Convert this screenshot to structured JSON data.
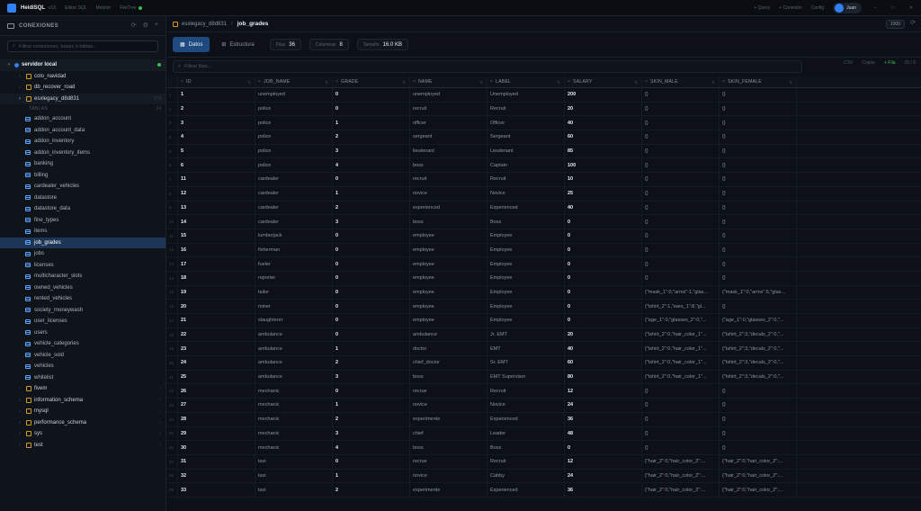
{
  "titlebar": {
    "app_name": "HeidiSQL",
    "version": "v13",
    "links": [
      "Editor SQL",
      "Monitor",
      "FileTree"
    ],
    "right": [
      "+ Query",
      "+ Conexión",
      "Config"
    ],
    "user": "Juan"
  },
  "sidebar": {
    "title": "CONEXIONES",
    "search_placeholder": "Filtrar conexiones, bases o tablas...",
    "server": {
      "label": "servidor local"
    },
    "databases_before": [
      {
        "label": "colo_navidad"
      },
      {
        "label": "db_recover_road"
      }
    ],
    "active_db": {
      "label": "esxlegacy_d8d831",
      "count": "174"
    },
    "tables_section": "TABLAS",
    "tables_count": "24",
    "tables": [
      "addon_account",
      "addon_account_data",
      "addon_inventory",
      "addon_inventory_items",
      "banking",
      "billing",
      "cardealer_vehicles",
      "datastore",
      "datastore_data",
      "fine_types",
      "items",
      "job_grades",
      "jobs",
      "licenses",
      "multicharacter_slots",
      "owned_vehicles",
      "rented_vehicles",
      "society_moneywash",
      "user_licenses",
      "users",
      "vehicle_categories",
      "vehicle_sold",
      "vehicles",
      "whitelist"
    ],
    "active_table": "job_grades",
    "databases_after": [
      {
        "label": "fivem"
      },
      {
        "label": "information_schema"
      },
      {
        "label": "mysql"
      },
      {
        "label": "performance_schema"
      },
      {
        "label": "sys"
      },
      {
        "label": "test"
      }
    ]
  },
  "crumb": {
    "db": "esxlegacy_d8d831",
    "table": "job_grades",
    "rows_badge": "1000"
  },
  "tabs": [
    {
      "label": "Datos",
      "icon": "grid-icon",
      "active": true
    },
    {
      "label": "Estructura",
      "icon": "structure-icon",
      "active": false
    }
  ],
  "stats": [
    {
      "k": "Filas",
      "v": "36"
    },
    {
      "k": "Columnas",
      "v": "8"
    },
    {
      "k": "Tamaño",
      "v": "16.0 KB"
    }
  ],
  "filter_placeholder": "Filtrar filas...",
  "filter_actions": [
    "CSV",
    "Copiar",
    "+ Fila",
    "25 / 8"
  ],
  "columns": [
    "ID",
    "JOB_NAME",
    "GRADE",
    "NAME",
    "LABEL",
    "SALARY",
    "SKIN_MALE",
    "SKIN_FEMALE"
  ],
  "rows": [
    [
      "1",
      "1",
      "unemployed",
      "0",
      "unemployed",
      "Unemployed",
      "200",
      "{}",
      "{}"
    ],
    [
      "2",
      "2",
      "police",
      "0",
      "recruit",
      "Recruit",
      "20",
      "{}",
      "{}"
    ],
    [
      "3",
      "3",
      "police",
      "1",
      "officer",
      "Officer",
      "40",
      "{}",
      "{}"
    ],
    [
      "4",
      "4",
      "police",
      "2",
      "sergeant",
      "Sergeant",
      "60",
      "{}",
      "{}"
    ],
    [
      "5",
      "5",
      "police",
      "3",
      "lieutenant",
      "Lieutenant",
      "85",
      "{}",
      "{}"
    ],
    [
      "6",
      "6",
      "police",
      "4",
      "boss",
      "Captain",
      "100",
      "{}",
      "{}"
    ],
    [
      "7",
      "11",
      "cardealer",
      "0",
      "recruit",
      "Recruit",
      "10",
      "{}",
      "{}"
    ],
    [
      "8",
      "12",
      "cardealer",
      "1",
      "novice",
      "Novice",
      "25",
      "{}",
      "{}"
    ],
    [
      "9",
      "13",
      "cardealer",
      "2",
      "experienced",
      "Experienced",
      "40",
      "{}",
      "{}"
    ],
    [
      "10",
      "14",
      "cardealer",
      "3",
      "boss",
      "Boss",
      "0",
      "{}",
      "{}"
    ],
    [
      "11",
      "15",
      "lumberjack",
      "0",
      "employee",
      "Employee",
      "0",
      "{}",
      "{}"
    ],
    [
      "12",
      "16",
      "fisherman",
      "0",
      "employee",
      "Employee",
      "0",
      "{}",
      "{}"
    ],
    [
      "13",
      "17",
      "fueler",
      "0",
      "employee",
      "Employee",
      "0",
      "{}",
      "{}"
    ],
    [
      "14",
      "18",
      "reporter",
      "0",
      "employee",
      "Employee",
      "0",
      "{}",
      "{}"
    ],
    [
      "15",
      "19",
      "tailor",
      "0",
      "employee",
      "Employee",
      "0",
      "{\"mask_1\":0,\"arms\":1,\"glas...",
      "{\"mask_1\":0,\"arms\":5,\"glas..."
    ],
    [
      "16",
      "20",
      "miner",
      "0",
      "employee",
      "Employee",
      "0",
      "{\"tshirt_2\":1,\"ears_1\":8,\"gl...",
      "{}"
    ],
    [
      "17",
      "21",
      "slaughterer",
      "0",
      "employee",
      "Employee",
      "0",
      "{\"age_1\":0,\"glasses_2\":0,\"...",
      "{\"age_1\":0,\"glasses_2\":0,\"..."
    ],
    [
      "18",
      "22",
      "ambulance",
      "0",
      "ambulance",
      "Jr. EMT",
      "20",
      "{\"tshirt_2\":0,\"hair_color_1\"...",
      "{\"tshirt_2\":3,\"decals_2\":0,\"..."
    ],
    [
      "19",
      "23",
      "ambulance",
      "1",
      "doctor",
      "EMT",
      "40",
      "{\"tshirt_2\":0,\"hair_color_1\"...",
      "{\"tshirt_2\":3,\"decals_2\":0,\"..."
    ],
    [
      "20",
      "24",
      "ambulance",
      "2",
      "chief_doctor",
      "Sr. EMT",
      "60",
      "{\"tshirt_2\":0,\"hair_color_1\"...",
      "{\"tshirt_2\":3,\"decals_2\":0,\"..."
    ],
    [
      "21",
      "25",
      "ambulance",
      "3",
      "boss",
      "EMT Supervisor",
      "80",
      "{\"tshirt_2\":0,\"hair_color_1\"...",
      "{\"tshirt_2\":3,\"decals_2\":0,\"..."
    ],
    [
      "22",
      "26",
      "mechanic",
      "0",
      "recrue",
      "Recruit",
      "12",
      "{}",
      "{}"
    ],
    [
      "23",
      "27",
      "mechanic",
      "1",
      "novice",
      "Novice",
      "24",
      "{}",
      "{}"
    ],
    [
      "24",
      "28",
      "mechanic",
      "2",
      "experimente",
      "Experienced",
      "36",
      "{}",
      "{}"
    ],
    [
      "25",
      "29",
      "mechanic",
      "3",
      "chief",
      "Leader",
      "48",
      "{}",
      "{}"
    ],
    [
      "26",
      "30",
      "mechanic",
      "4",
      "boss",
      "Boss",
      "0",
      "{}",
      "{}"
    ],
    [
      "27",
      "31",
      "taxi",
      "0",
      "recrue",
      "Recruit",
      "12",
      "{\"hair_2\":0,\"hair_color_2\":...",
      "{\"hair_2\":0,\"hair_color_2\":..."
    ],
    [
      "28",
      "32",
      "taxi",
      "1",
      "novice",
      "Cabby",
      "24",
      "{\"hair_2\":0,\"hair_color_2\":...",
      "{\"hair_2\":0,\"hair_color_2\":..."
    ],
    [
      "29",
      "33",
      "taxi",
      "2",
      "experimente",
      "Experienced",
      "36",
      "{\"hair_2\":0,\"hair_color_2\":...",
      "{\"hair_2\":0,\"hair_color_2\":..."
    ]
  ]
}
